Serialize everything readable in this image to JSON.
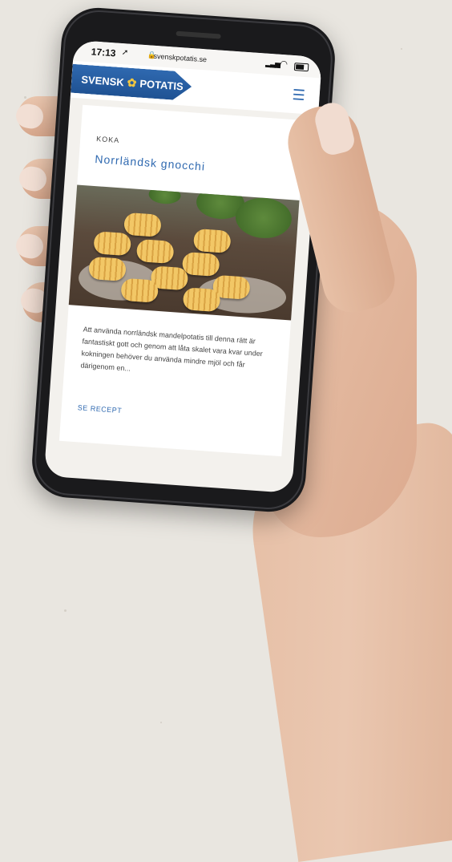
{
  "status_bar": {
    "time": "17:13",
    "location_icon": "location-arrow-icon",
    "url": "svenskpotatis.se"
  },
  "header": {
    "logo_left": "SVENSK",
    "logo_right": "POTATIS",
    "logo_color": "#2f69b0",
    "menu_icon": "hamburger-menu-icon"
  },
  "card": {
    "category": "KOKA",
    "title": "Norrländsk gnocchi",
    "description": "Att använda norrländsk mandelpotatis till denna rätt är fantastiskt gott och genom att låta skalet vara kvar under kokningen behöver du använda mindre mjöl och får därigenom en...",
    "cta": "SE RECEPT"
  }
}
